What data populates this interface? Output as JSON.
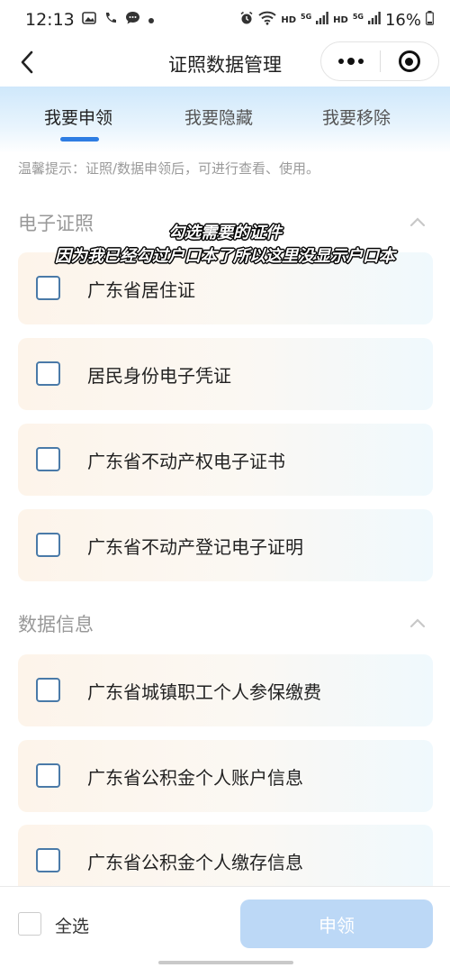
{
  "status_bar": {
    "time": "12:13",
    "left_icons": [
      "image-icon",
      "phone-icon",
      "chat-icon",
      "dot-icon"
    ],
    "right_icons": [
      "alarm-icon",
      "wifi-icon",
      "signal-icon",
      "signal-icon",
      "battery-icon"
    ],
    "hd_1": "HD",
    "hd_2": "HD",
    "net_1": "5G",
    "net_2": "5G",
    "battery": "16%"
  },
  "nav": {
    "title": "证照数据管理"
  },
  "tabs": [
    {
      "label": "我要申领",
      "active": true
    },
    {
      "label": "我要隐藏",
      "active": false
    },
    {
      "label": "我要移除",
      "active": false
    }
  ],
  "notice": "温馨提示：证照/数据申领后，可进行查看、使用。",
  "sections": [
    {
      "title": "电子证照",
      "items": [
        "广东省居住证",
        "居民身份电子凭证",
        "广东省不动产权电子证书",
        "广东省不动产登记电子证明"
      ]
    },
    {
      "title": "数据信息",
      "items": [
        "广东省城镇职工个人参保缴费",
        "广东省公积金个人账户信息",
        "广东省公积金个人缴存信息"
      ]
    }
  ],
  "overlay": {
    "line1": "勾选需要的证件",
    "line2": "因为我已经勾过户口本了所以这里没显示户口本"
  },
  "footer": {
    "select_all": "全选",
    "apply": "申领"
  },
  "colors": {
    "accent": "#2e7de3",
    "apply_disabled": "#bcd8f6",
    "checkbox_border": "#4a7aa8"
  }
}
